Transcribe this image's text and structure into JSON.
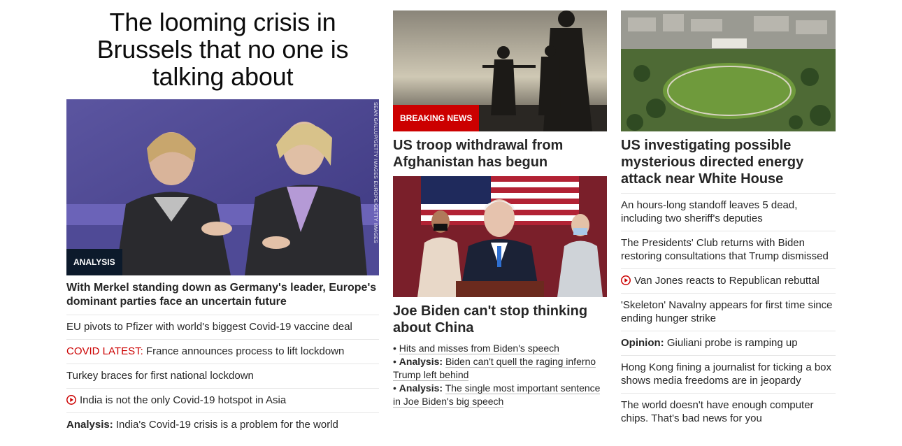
{
  "col1": {
    "headline": "The looming crisis in Brussels that no one is talking about",
    "photo_credit": "SEAN GALLUP/GETTY IMAGES EUROPE/GETTY IMAGES",
    "badge": "ANALYSIS",
    "lead": "With Merkel standing down as Germany's leader, Europe's dominant parties face an uncertain future",
    "items": [
      {
        "text": "EU pivots to Pfizer with world's biggest Covid-19 vaccine deal"
      },
      {
        "prefix": "COVID LATEST:",
        "text": " France announces process to lift lockdown"
      },
      {
        "text": "Turkey braces for first national lockdown"
      },
      {
        "text": "India is not the only Covid-19 hotspot in Asia",
        "video": true
      },
      {
        "prefix": "Analysis:",
        "text": " India's Covid-19 crisis is a problem for the world"
      }
    ]
  },
  "col2": {
    "badge": "BREAKING NEWS",
    "lead1": "US troop withdrawal from Afghanistan has begun",
    "lead2": "Joe Biden can't stop thinking about China",
    "bullets": [
      {
        "text": "Hits and misses from Biden's speech"
      },
      {
        "prefix": "Analysis:",
        "text": "Biden can't quell the raging inferno Trump left behind"
      },
      {
        "prefix": "Analysis:",
        "text": "The single most important sentence in Joe Biden's big speech"
      }
    ]
  },
  "col3": {
    "lead": "US investigating possible mysterious directed energy attack near White House",
    "items": [
      {
        "text": "An hours-long standoff leaves 5 dead, including two sheriff's deputies"
      },
      {
        "text": "The Presidents' Club returns with Biden restoring consultations that Trump dismissed"
      },
      {
        "text": "Van Jones reacts to Republican rebuttal",
        "video": true
      },
      {
        "text": "'Skeleton' Navalny appears for first time since ending hunger strike"
      },
      {
        "prefix": "Opinion:",
        "text": " Giuliani probe is ramping up"
      },
      {
        "text": "Hong Kong fining a journalist for ticking a box shows media freedoms are in jeopardy"
      },
      {
        "text": "The world doesn't have enough computer chips. That's bad news for you"
      }
    ]
  },
  "colors": {
    "accent_red": "#cc0000",
    "analysis_badge": "#0c1a2b"
  }
}
